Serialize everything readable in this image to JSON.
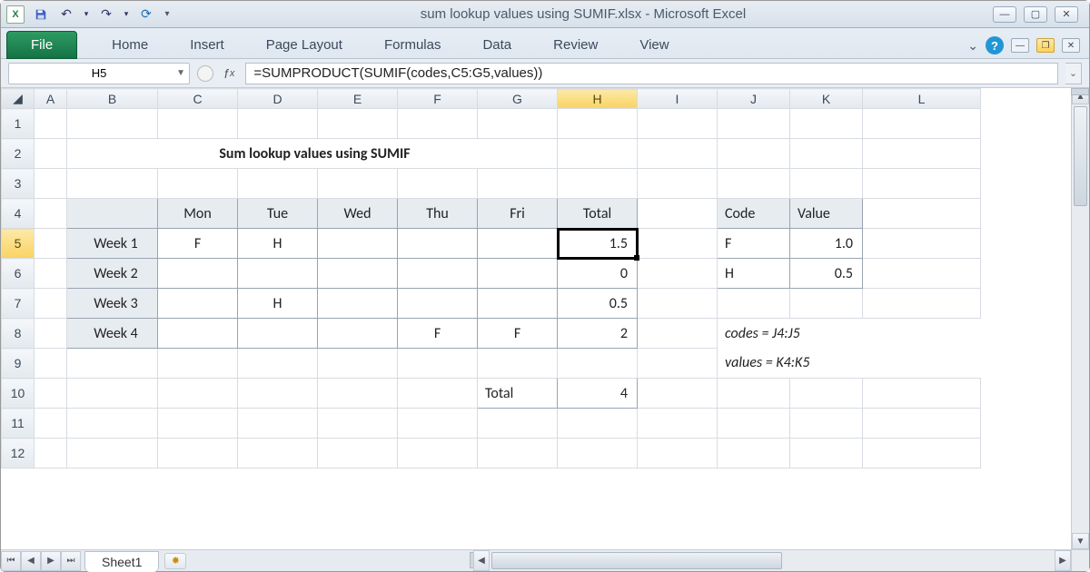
{
  "app": {
    "title": "sum lookup values using SUMIF.xlsx  -  Microsoft Excel"
  },
  "ribbon": {
    "file": "File",
    "tabs": [
      "Home",
      "Insert",
      "Page Layout",
      "Formulas",
      "Data",
      "Review",
      "View"
    ]
  },
  "namebox": "H5",
  "formula": "=SUMPRODUCT(SUMIF(codes,C5:G5,values))",
  "columns": [
    "A",
    "B",
    "C",
    "D",
    "E",
    "F",
    "G",
    "H",
    "I",
    "J",
    "K",
    "L"
  ],
  "rows": [
    "1",
    "2",
    "3",
    "4",
    "5",
    "6",
    "7",
    "8",
    "9",
    "10",
    "11",
    "12"
  ],
  "selected": {
    "col": "H",
    "row": "5"
  },
  "sheet": {
    "title": "Sum lookup values using SUMIF",
    "headers": [
      "Mon",
      "Tue",
      "Wed",
      "Thu",
      "Fri",
      "Total"
    ],
    "weeks": [
      {
        "label": "Week 1",
        "cells": [
          "F",
          "H",
          "",
          "",
          "",
          ""
        ],
        "total": "1.5"
      },
      {
        "label": "Week 2",
        "cells": [
          "",
          "",
          "",
          "",
          "",
          ""
        ],
        "total": "0"
      },
      {
        "label": "Week 3",
        "cells": [
          "",
          "H",
          "",
          "",
          "",
          ""
        ],
        "total": "0.5"
      },
      {
        "label": "Week 4",
        "cells": [
          "",
          "",
          "",
          "F",
          "F",
          ""
        ],
        "total": "2"
      }
    ],
    "grand_label": "Total",
    "grand_total": "4",
    "lookup_headers": [
      "Code",
      "Value"
    ],
    "lookup": [
      {
        "code": "F",
        "value": "1.0"
      },
      {
        "code": "H",
        "value": "0.5"
      }
    ],
    "notes": [
      "codes = J4:J5",
      "values = K4:K5"
    ]
  },
  "tabs": {
    "active": "Sheet1"
  }
}
